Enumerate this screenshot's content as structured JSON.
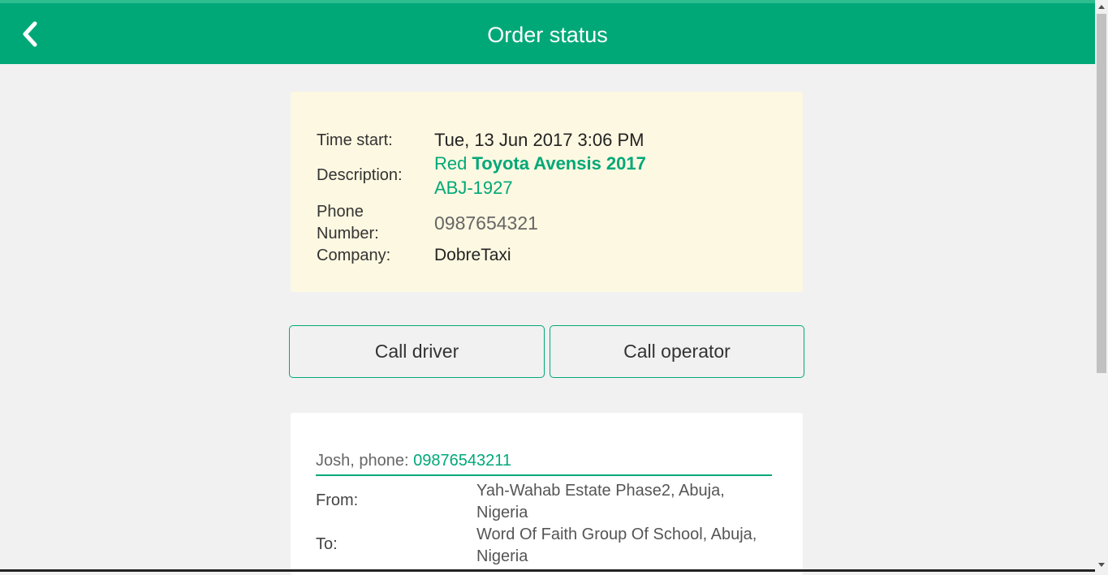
{
  "header": {
    "title": "Order status",
    "back_icon": "chevron-left-icon"
  },
  "order": {
    "time_start_label": "Time start:",
    "time_start_value": "Tue, 13 Jun 2017 3:06 PM",
    "description_label": "Description:",
    "car_color": "Red",
    "car_model": "Toyota Avensis 2017",
    "plate": "ABJ-1927",
    "phone_label_line1": "Phone",
    "phone_label_line2": "Number:",
    "phone_value": "0987654321",
    "company_label": "Company:",
    "company_value": "DobreTaxi"
  },
  "actions": {
    "call_driver": "Call driver",
    "call_operator": "Call operator"
  },
  "route": {
    "passenger_prefix": "Josh, phone: ",
    "passenger_phone": "09876543211",
    "from_label": "From:",
    "from_line1": "Yah-Wahab Estate Phase2, Abuja,",
    "from_line2": "Nigeria",
    "to_label": "To:",
    "to_line1": "Word Of Faith Group Of School, Abuja,",
    "to_line2": "Nigeria"
  },
  "colors": {
    "brand": "#00a878",
    "card_bg": "#fdf8e1",
    "page_bg": "#f1f1f1"
  }
}
